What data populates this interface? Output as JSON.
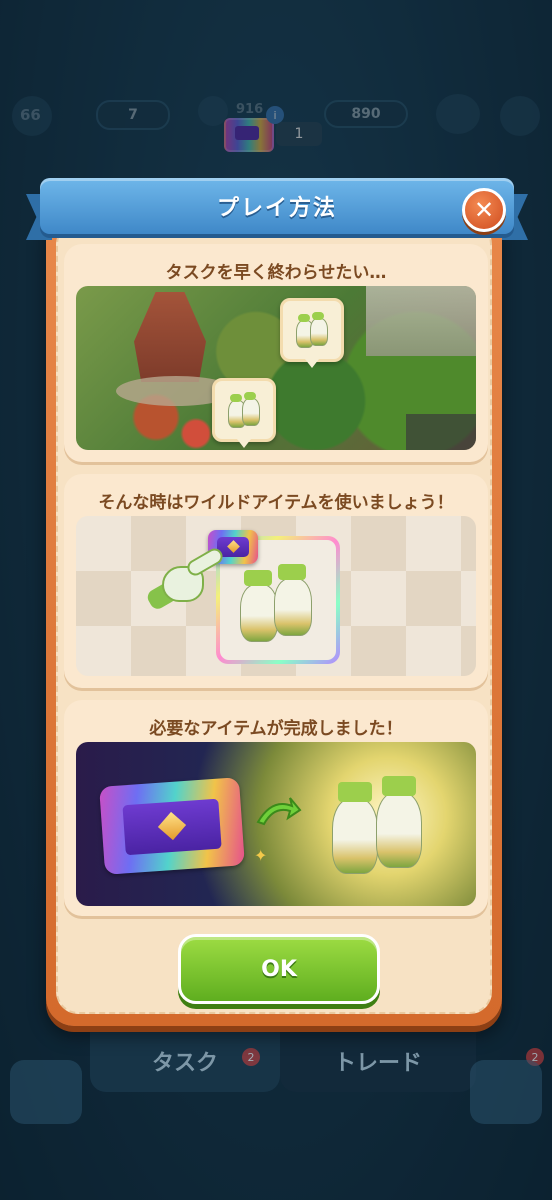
{
  "hud": {
    "level": "66",
    "energy": "7",
    "coins": "916",
    "gems": "890",
    "wild_count": "1",
    "wild_badge": "i"
  },
  "dialog": {
    "title": "プレイ方法",
    "close_icon": "close-x-icon",
    "sections": [
      {
        "title": "タスクを早く終わらせたい…"
      },
      {
        "title": "そんな時はワイルドアイテムを使いましょう！"
      },
      {
        "title": "必要なアイテムが完成しました！"
      }
    ],
    "ok_label": "OK"
  },
  "bottom_tabs": [
    {
      "label": "タスク",
      "badge": "2"
    },
    {
      "label": "トレード",
      "badge": "2"
    }
  ],
  "colors": {
    "banner": "#3f88c8",
    "panel": "#d46a2c",
    "ok": "#5fae1f"
  }
}
